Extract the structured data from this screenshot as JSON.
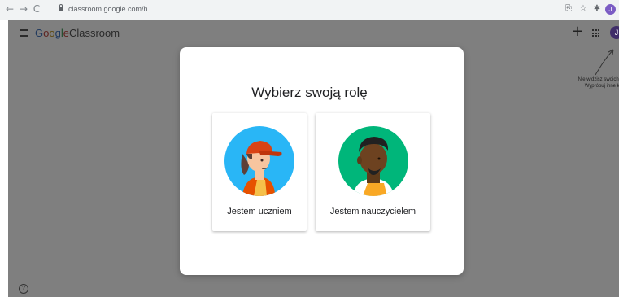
{
  "browser": {
    "url": "classroom.google.com/h",
    "profile_initial": "J"
  },
  "header": {
    "logo_parts": [
      "G",
      "o",
      "o",
      "g",
      "l",
      "e"
    ],
    "logo_product": "Classroom",
    "plus_label": "+",
    "avatar_initial": "J"
  },
  "hint": {
    "line1": "Nie widzisz swoich zaj",
    "line2": "Wypróbuj inne kont"
  },
  "dialog": {
    "title": "Wybierz swoją rolę",
    "roles": [
      {
        "label": "Jestem uczniem",
        "icon": "student-illustration"
      },
      {
        "label": "Jestem nauczycielem",
        "icon": "teacher-illustration"
      }
    ]
  },
  "help": {
    "label": "?"
  },
  "colors": {
    "overlay": "#7f7f7f",
    "dialog_bg": "#ffffff",
    "student_circle": "#29b6f6",
    "teacher_circle": "#00b67a"
  }
}
